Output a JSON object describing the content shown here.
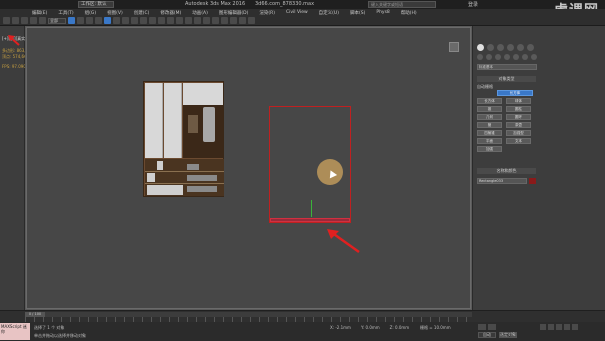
{
  "titlebar": {
    "workspace": "工作区: 默认",
    "app_title": "Autodesk 3ds Max 2016",
    "file_name": "3d66.com_878330.max",
    "search_placeholder": "键入关键字或短语",
    "login": "登录",
    "watermark": "虎课网"
  },
  "menu": [
    "编辑(E)",
    "工具(T)",
    "组(G)",
    "视图(V)",
    "创建(C)",
    "修改器(M)",
    "动画(A)",
    "图形编辑器(D)",
    "渲染(R)",
    "Civil View",
    "自定义(U)",
    "脚本(S)",
    "Phys8",
    "帮助(H)"
  ],
  "toolbar": {
    "selection_filter": "全部"
  },
  "left_strip": {
    "viewport_label": "[+][前][真实]",
    "stats_label_1": "多边形: 863,578",
    "stats_label_2": "顶点: 574,666",
    "stats_label_3": "FPS: 97.090"
  },
  "command_panel": {
    "search_value": "标准基本",
    "object_type_header": "对象类型",
    "auto_grid": "自动栅格",
    "buttons": [
      {
        "label": "长方体",
        "active": true
      },
      {
        "label": "球体"
      },
      {
        "label": "几何球体"
      },
      {
        "label": "圆柱体"
      },
      {
        "label": "管状体"
      },
      {
        "label": "圆环"
      },
      {
        "label": "四棱锥"
      },
      {
        "label": "茶壶"
      },
      {
        "label": "平面"
      },
      {
        "label": "加强型文本"
      }
    ],
    "col1": [
      "长方体",
      "锥",
      "几何",
      "管",
      "四棱锥",
      "平面",
      "加强"
    ],
    "col2": [
      "球体",
      "圆柱",
      "圆环",
      "茶壶",
      "加强型",
      "文本"
    ],
    "name_color_header": "名称和颜色",
    "object_name": "Rectangle033",
    "color": "#8a1a1a"
  },
  "timeline": {
    "frame": "0 / 100"
  },
  "status": {
    "maxscript": "MAXScript 迷你",
    "line1": "选择了 1 个 对象",
    "line2": "单击并拖动以选择并移动对象",
    "x": "X: -2.1mm",
    "y": "Y: 0.0mm",
    "z": "Z: 0.0mm",
    "grid": "栅格 = 10.0mm",
    "add_time_tag": "添加时间标记",
    "auto_key": "自动",
    "set_key": "设置关键点",
    "selected": "选定对象"
  }
}
